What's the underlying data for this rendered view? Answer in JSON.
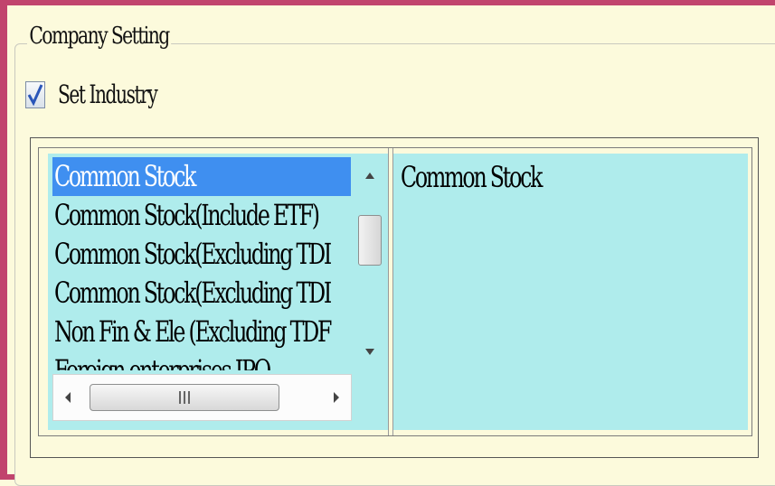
{
  "group": {
    "title": "Company Setting"
  },
  "set_industry": {
    "label": "Set Industry",
    "checked": true
  },
  "industry_list": {
    "items": [
      "Common Stock",
      "Common Stock(Include ETF)",
      "Common Stock(Excluding TDI",
      "Common Stock(Excluding TDI",
      "Non Fin & Ele (Excluding TDF",
      "Foreign enterprises IPO"
    ],
    "selected_index": 0
  },
  "detail": {
    "text": "Common Stock"
  },
  "colors": {
    "window_border": "#c1446d",
    "background": "#fcfadc",
    "list_background": "#afecec",
    "selection": "#3f8ff0"
  },
  "icons": {
    "checkbox": "check-icon",
    "scroll_up": "arrow-up-icon",
    "scroll_down": "arrow-down-icon",
    "scroll_left": "arrow-left-icon",
    "scroll_right": "arrow-right-icon",
    "thumb_grip": "grip-icon"
  }
}
